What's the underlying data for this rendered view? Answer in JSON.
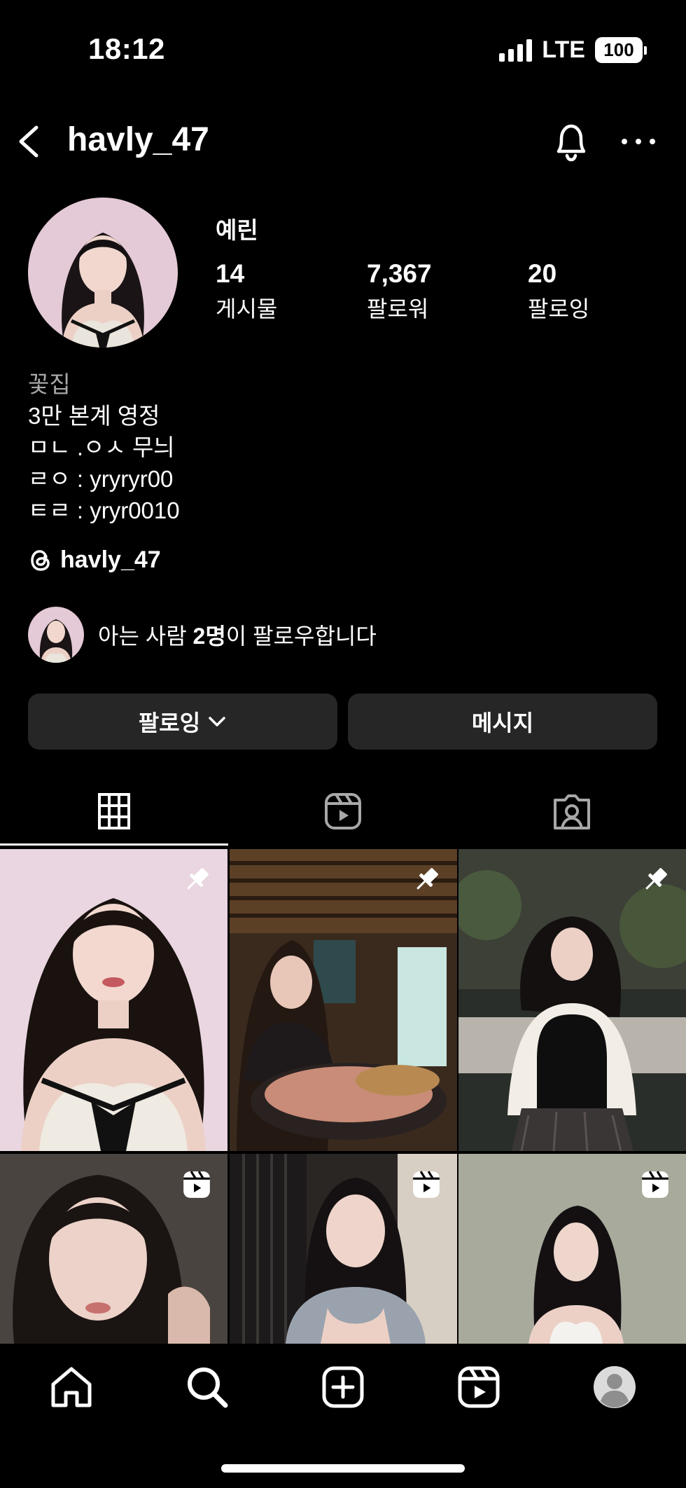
{
  "status_bar": {
    "time": "18:12",
    "network": "LTE",
    "battery": "100"
  },
  "header": {
    "username": "havly_47"
  },
  "profile": {
    "display_name": "예린",
    "stats": [
      {
        "value": "14",
        "label": "게시물"
      },
      {
        "value": "7,367",
        "label": "팔로워"
      },
      {
        "value": "20",
        "label": "팔로잉"
      }
    ],
    "bio": {
      "category": "꽃집",
      "lines": [
        "3만 본계 영정",
        "ㅁㄴ .ㅇㅅ 무늬",
        "ㄹㅇ : yryryr00",
        "ㅌㄹ : yryr0010"
      ]
    },
    "threads_handle": "havly_47",
    "mutual": {
      "prefix": "아는 사람 ",
      "count": "2명",
      "suffix": "이 팔로우합니다"
    }
  },
  "actions": {
    "following_label": "팔로잉",
    "message_label": "메시지"
  },
  "tabs": [
    {
      "name": "posts",
      "icon": "grid-icon",
      "active": true
    },
    {
      "name": "reels",
      "icon": "reels-icon",
      "active": false
    },
    {
      "name": "tagged",
      "icon": "tagged-icon",
      "active": false
    }
  ],
  "grid": [
    {
      "type": "pinned",
      "icon": "pin-icon"
    },
    {
      "type": "pinned",
      "icon": "pin-icon"
    },
    {
      "type": "pinned",
      "icon": "pin-icon"
    },
    {
      "type": "reel",
      "icon": "reels-icon"
    },
    {
      "type": "reel",
      "icon": "reels-icon"
    },
    {
      "type": "reel",
      "icon": "reels-icon"
    }
  ],
  "bottom_nav": [
    "home-icon",
    "search-icon",
    "create-icon",
    "reels-icon",
    "profile-avatar"
  ]
}
